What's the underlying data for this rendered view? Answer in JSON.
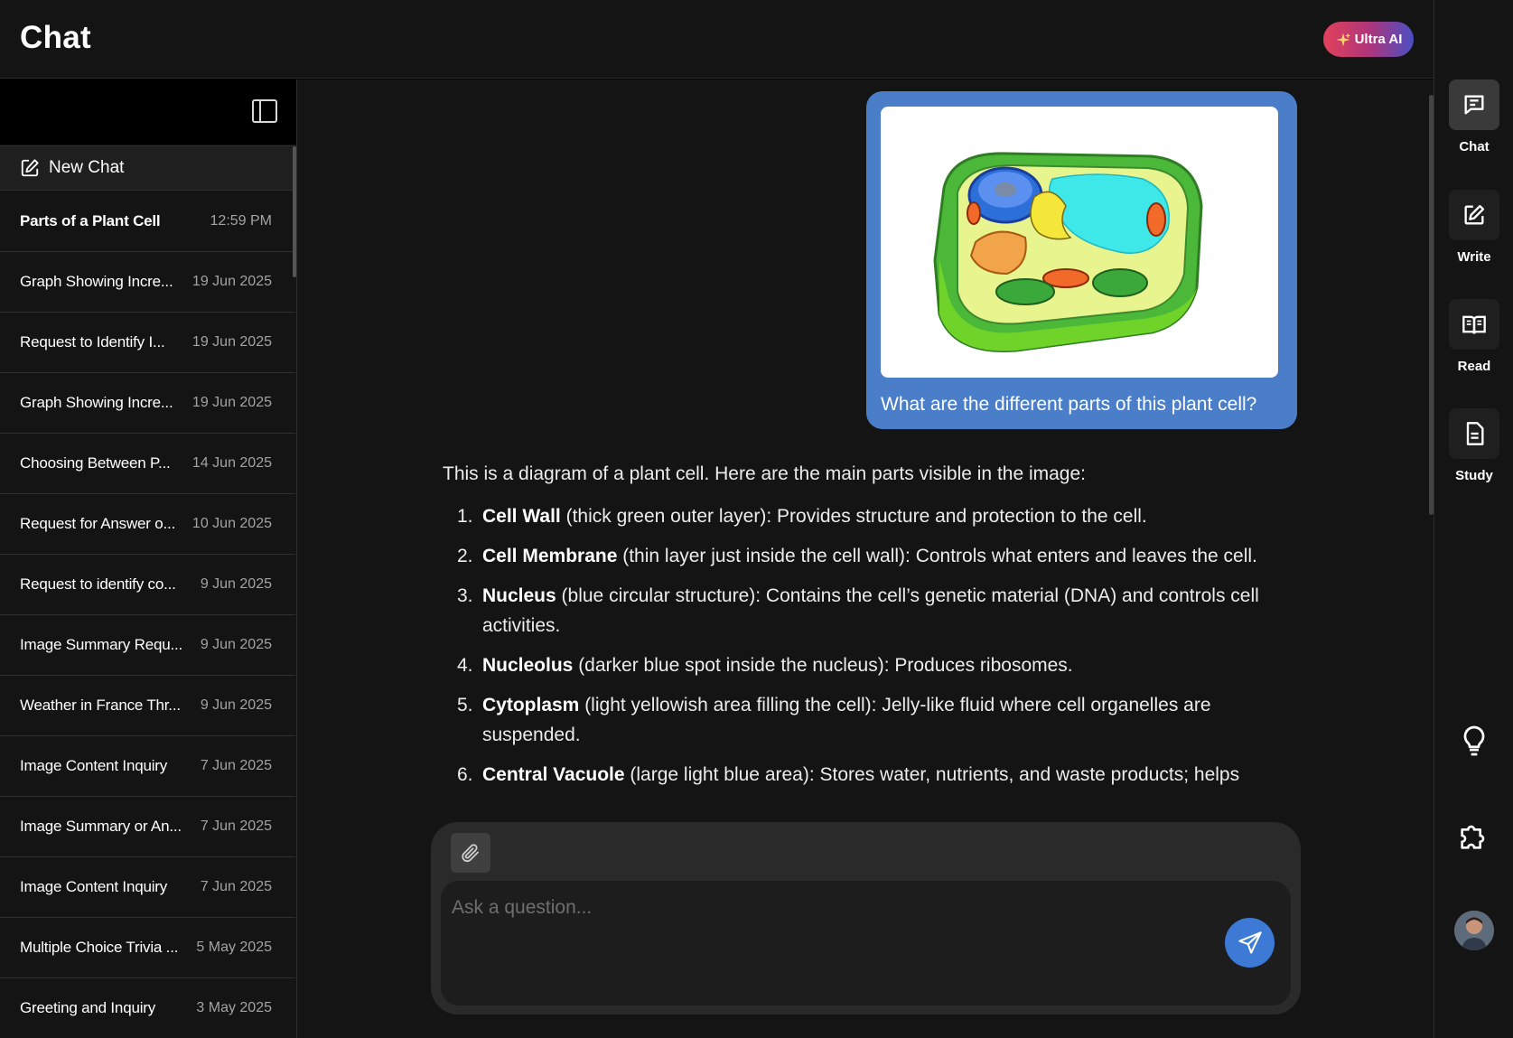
{
  "header": {
    "title": "Chat",
    "ultra_label": "Ultra AI"
  },
  "sidebar": {
    "new_chat_label": "New Chat",
    "chats": [
      {
        "title": "Parts of a Plant Cell",
        "date": "12:59 PM",
        "active": true
      },
      {
        "title": "Graph Showing Incre...",
        "date": "19 Jun 2025"
      },
      {
        "title": "Request to Identify I...",
        "date": "19 Jun 2025"
      },
      {
        "title": "Graph Showing Incre...",
        "date": "19 Jun 2025"
      },
      {
        "title": "Choosing Between P...",
        "date": "14 Jun 2025"
      },
      {
        "title": "Request for Answer o...",
        "date": "10 Jun 2025"
      },
      {
        "title": "Request to identify co...",
        "date": "9 Jun 2025"
      },
      {
        "title": "Image Summary Requ...",
        "date": "9 Jun 2025"
      },
      {
        "title": "Weather in France Thr...",
        "date": "9 Jun 2025"
      },
      {
        "title": "Image Content Inquiry",
        "date": "7 Jun 2025"
      },
      {
        "title": "Image Summary or An...",
        "date": "7 Jun 2025"
      },
      {
        "title": "Image Content Inquiry",
        "date": "7 Jun 2025"
      },
      {
        "title": "Multiple Choice Trivia ...",
        "date": "5 May 2025"
      },
      {
        "title": "Greeting and Inquiry",
        "date": "3 May 2025"
      }
    ]
  },
  "conversation": {
    "user_message": "What are the different parts of this plant cell?",
    "answer_intro": "This is a diagram of a plant cell. Here are the main parts visible in the image:",
    "answer_items": [
      {
        "num": "1.",
        "term": "Cell Wall",
        "text": " (thick green outer layer): Provides structure and protection to the cell."
      },
      {
        "num": "2.",
        "term": "Cell Membrane",
        "text": " (thin layer just inside the cell wall): Controls what enters and leaves the cell."
      },
      {
        "num": "3.",
        "term": "Nucleus",
        "text": " (blue circular structure): Contains the cell’s genetic material (DNA) and controls cell activities."
      },
      {
        "num": "4.",
        "term": "Nucleolus",
        "text": " (darker blue spot inside the nucleus): Produces ribosomes."
      },
      {
        "num": "5.",
        "term": "Cytoplasm",
        "text": " (light yellowish area filling the cell): Jelly-like fluid where cell organelles are suspended."
      },
      {
        "num": "6.",
        "term": "Central Vacuole",
        "text": " (large light blue area): Stores water, nutrients, and waste products; helps"
      }
    ]
  },
  "composer": {
    "placeholder": "Ask a question..."
  },
  "rail": {
    "items": [
      {
        "label": "Chat",
        "icon": "chat-icon"
      },
      {
        "label": "Write",
        "icon": "edit-icon"
      },
      {
        "label": "Read",
        "icon": "book-icon"
      },
      {
        "label": "Study",
        "icon": "document-icon"
      }
    ],
    "extra_icons": [
      "lightbulb-icon",
      "puzzle-icon"
    ]
  },
  "colors": {
    "accent": "#3d7ad6",
    "bubble": "#4a7ec9",
    "background": "#141414"
  }
}
